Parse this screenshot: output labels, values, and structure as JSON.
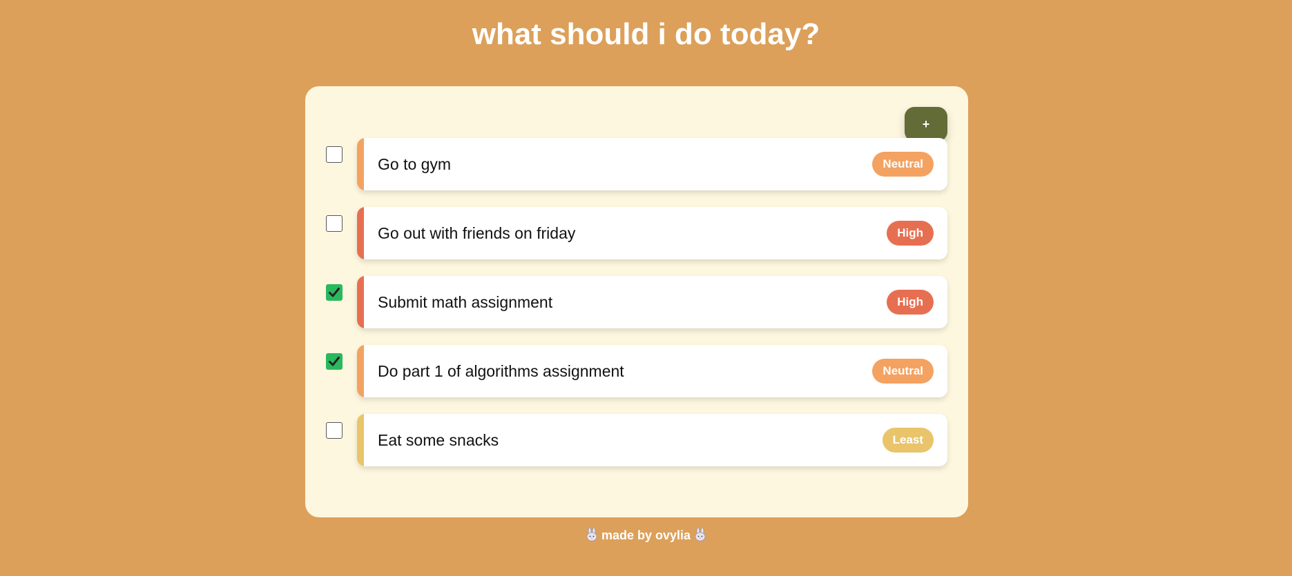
{
  "title": "what should i do today?",
  "add_button_label": "+",
  "colors": {
    "background": "#dca05a",
    "card": "#fdf7df",
    "add_button": "#636b37",
    "checked": "#2ab85f",
    "priority_neutral": "#f4a261",
    "priority_high": "#e76f51",
    "priority_least": "#e9c46a"
  },
  "tasks": [
    {
      "label": "Go to gym",
      "priority": "Neutral",
      "checked": false
    },
    {
      "label": "Go out with friends on friday",
      "priority": "High",
      "checked": false
    },
    {
      "label": "Submit math assignment",
      "priority": "High",
      "checked": true
    },
    {
      "label": "Do part 1 of algorithms assignment",
      "priority": "Neutral",
      "checked": true
    },
    {
      "label": "Eat some snacks",
      "priority": "Least",
      "checked": false
    }
  ],
  "footer": {
    "icon": "bunny-icon",
    "text": "made by ovylia"
  }
}
